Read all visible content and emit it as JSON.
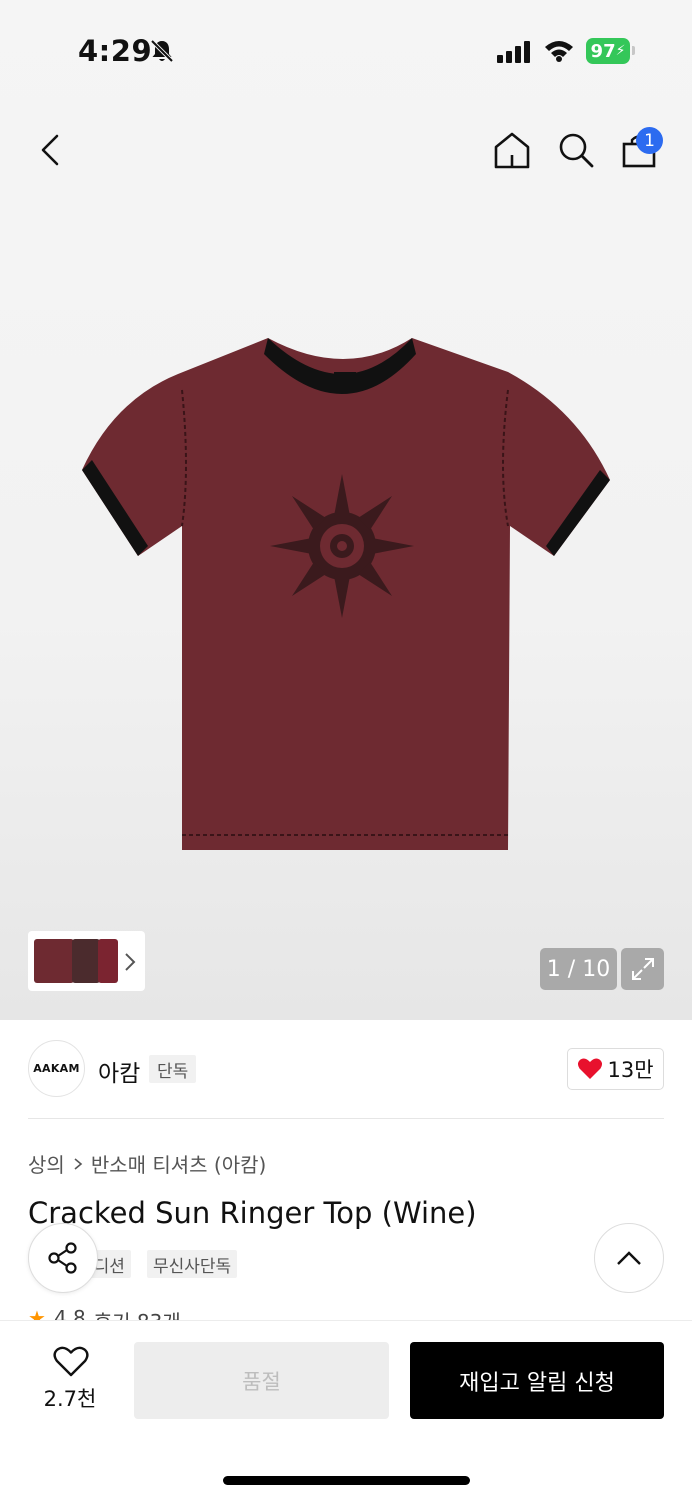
{
  "status_bar": {
    "time": "4:29",
    "battery": "97"
  },
  "header": {
    "cart_count": "1"
  },
  "gallery": {
    "counter": "1 / 10"
  },
  "brand": {
    "logo_text": "AAKAM",
    "name": "아캄",
    "exclusive_label": "단독",
    "likes": "13만"
  },
  "product": {
    "breadcrumb": [
      "상의",
      "반소매 티셔츠 (아캄)"
    ],
    "title": "Cracked Sun Ringer Top (Wine)",
    "tags": [
      "에디션",
      "무신사단독"
    ],
    "rating": "4.8",
    "reviews": "후기 83개"
  },
  "bottom_bar": {
    "wish_count": "2.7천",
    "soldout_label": "품절",
    "restock_label": "재입고 알림 신청"
  },
  "colors": {
    "shirt": "#6e2a31",
    "badge_blue": "#2c6bf0",
    "heart_red": "#e8112d",
    "battery_green": "#34c759"
  }
}
